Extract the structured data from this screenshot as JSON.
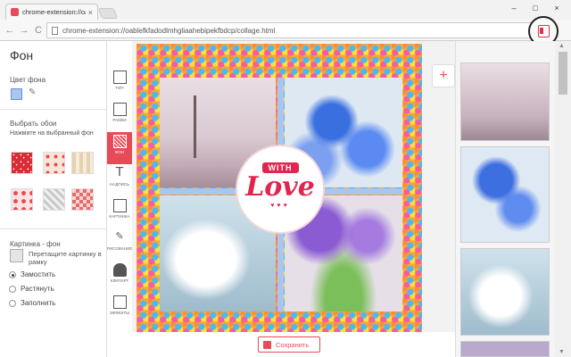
{
  "browser": {
    "tab_title": "chrome-extension://oabl",
    "tab_close": "×",
    "url": "chrome-extension://oablefkfadodlmhgliaahebipekfbdcp/collage.html",
    "back": "←",
    "forward": "→",
    "reload": "C",
    "menu": "≡",
    "min": "–",
    "max": "□",
    "close": "×"
  },
  "left_panel": {
    "title": "Фон",
    "bg_color_label": "Цвет фона",
    "eyedropper": "✎",
    "wallpaper_label": "Выбрать обои",
    "wallpaper_hint": "Нажмите на выбранный фон",
    "picture_label": "Картинка - фон",
    "drop_hint": "Перетащите картинку в рамку",
    "options": [
      {
        "label": "Замостить",
        "selected": true
      },
      {
        "label": "Растянуть",
        "selected": false
      },
      {
        "label": "Заполнить",
        "selected": false
      }
    ]
  },
  "tools": [
    {
      "label": "ТИП",
      "glyph": ""
    },
    {
      "label": "РАМКИ",
      "glyph": ""
    },
    {
      "label": "ФОН",
      "glyph": "",
      "active": true
    },
    {
      "label": "НАДПИСЬ",
      "glyph": "T"
    },
    {
      "label": "КАРТИНКА",
      "glyph": ""
    },
    {
      "label": "РИСОВАНИЕ",
      "glyph": "✎"
    },
    {
      "label": "КЛИПАРТ",
      "glyph": ""
    },
    {
      "label": "ЭФФЕКТЫ",
      "glyph": ""
    }
  ],
  "canvas": {
    "badge_top": "WITH",
    "badge_main": "Love",
    "badge_hearts": "♥♥♥",
    "add": "+"
  },
  "save_label": "Сохранить",
  "scroll": {
    "up": "▲",
    "down": "▼"
  },
  "colors": {
    "accent": "#e84b58",
    "love": "#e0264f",
    "divider": "#a9c6f3"
  }
}
